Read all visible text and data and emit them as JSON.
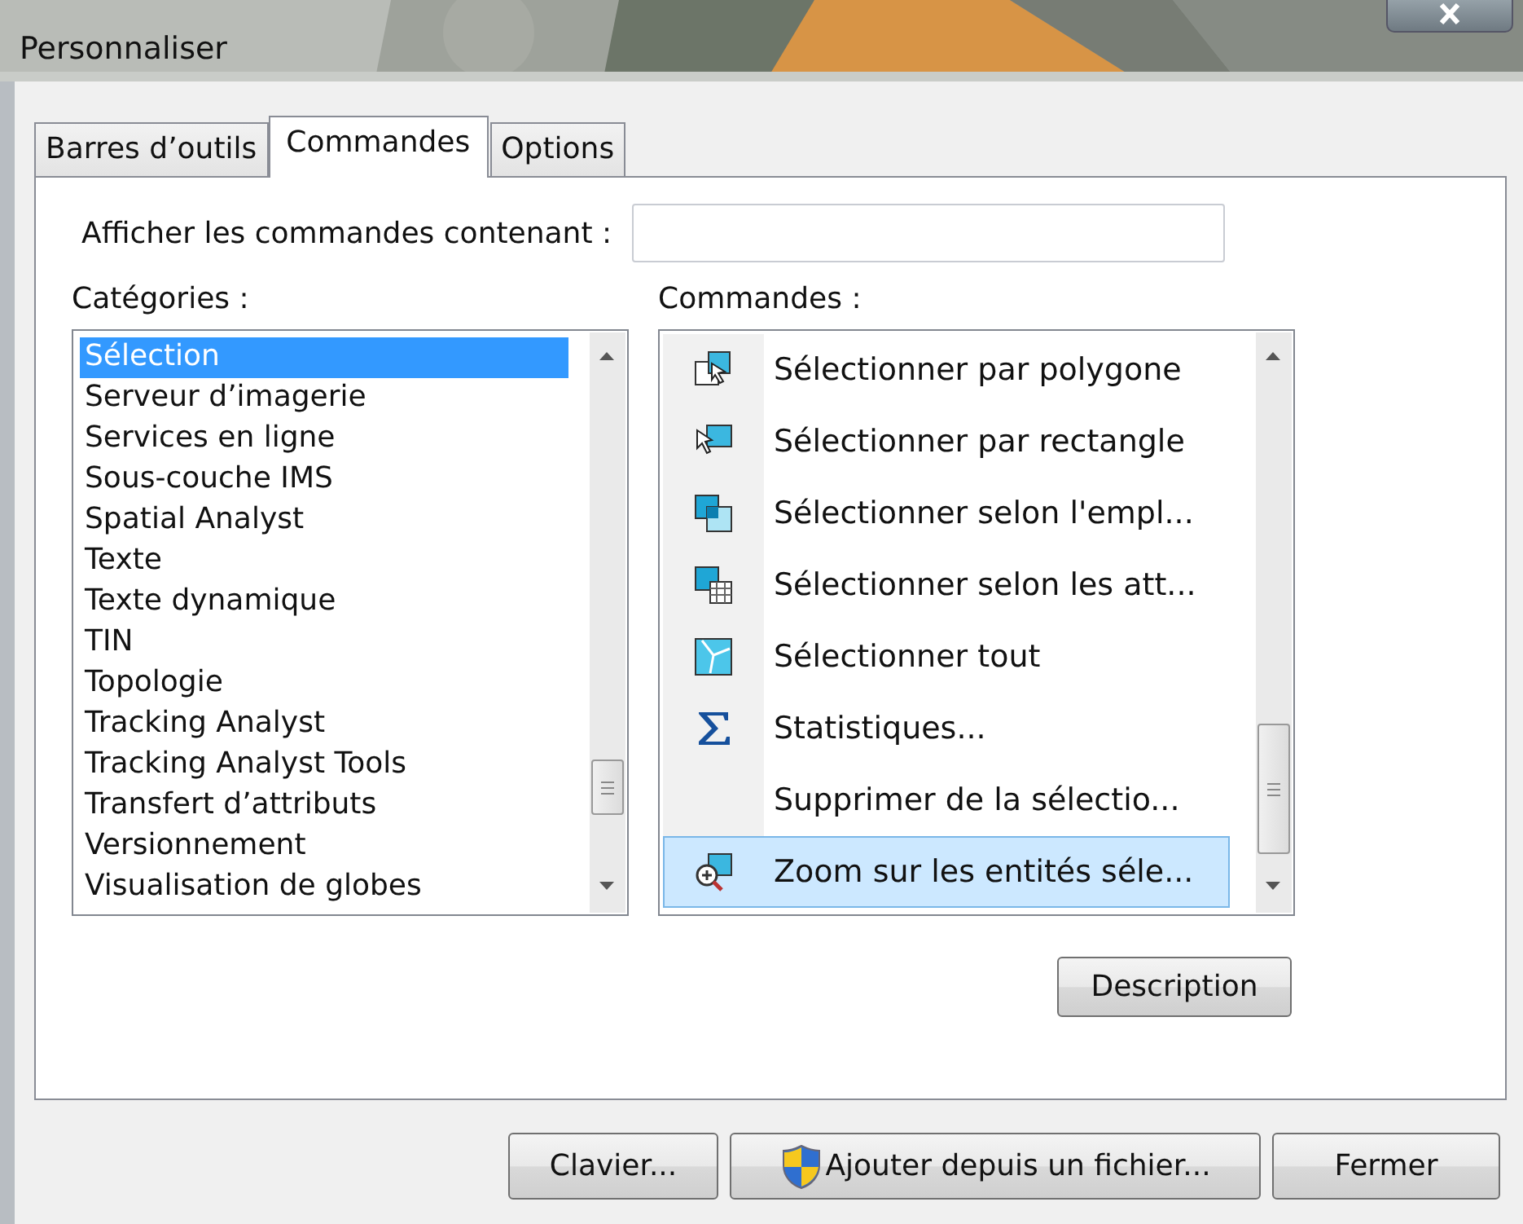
{
  "window": {
    "title": "Personnaliser"
  },
  "tabs": [
    {
      "label": "Barres d’outils",
      "selected": false
    },
    {
      "label": "Commandes",
      "selected": true
    },
    {
      "label": "Options",
      "selected": false
    }
  ],
  "filter": {
    "label": "Afficher les commandes contenant :"
  },
  "categories": {
    "label": "Catégories :",
    "items": [
      {
        "text": "Sélection",
        "selected": true
      },
      {
        "text": "Serveur d’imagerie",
        "selected": false
      },
      {
        "text": "Services en ligne",
        "selected": false
      },
      {
        "text": "Sous-couche IMS",
        "selected": false
      },
      {
        "text": "Spatial Analyst",
        "selected": false
      },
      {
        "text": "Texte",
        "selected": false
      },
      {
        "text": "Texte dynamique",
        "selected": false
      },
      {
        "text": "TIN",
        "selected": false
      },
      {
        "text": "Topologie",
        "selected": false
      },
      {
        "text": "Tracking Analyst",
        "selected": false
      },
      {
        "text": "Tracking Analyst Tools",
        "selected": false
      },
      {
        "text": "Transfert d’attributs",
        "selected": false
      },
      {
        "text": "Versionnement",
        "selected": false
      },
      {
        "text": "Visualisation de globes",
        "selected": false
      }
    ]
  },
  "commands": {
    "label": "Commandes :",
    "items": [
      {
        "text": "Sélectionner par polygone",
        "kind": "polygon",
        "selected": false
      },
      {
        "text": "Sélectionner par rectangle",
        "kind": "rectangle",
        "selected": false
      },
      {
        "text": "Sélectionner selon l'empl...",
        "kind": "location",
        "selected": false
      },
      {
        "text": "Sélectionner selon les att...",
        "kind": "attributes",
        "selected": false
      },
      {
        "text": "Sélectionner tout",
        "kind": "all",
        "selected": false
      },
      {
        "text": "Statistiques...",
        "kind": "sigma",
        "selected": false
      },
      {
        "text": "Supprimer de la sélectio...",
        "kind": "none",
        "selected": false
      },
      {
        "text": "Zoom sur les entités séle...",
        "kind": "zoom",
        "selected": true
      }
    ]
  },
  "description_button": "Description",
  "buttons": [
    {
      "label": "Clavier...",
      "kind": "plain"
    },
    {
      "label": "Ajouter depuis un fichier...",
      "kind": "shield"
    },
    {
      "label": "Fermer",
      "kind": "plain"
    }
  ]
}
